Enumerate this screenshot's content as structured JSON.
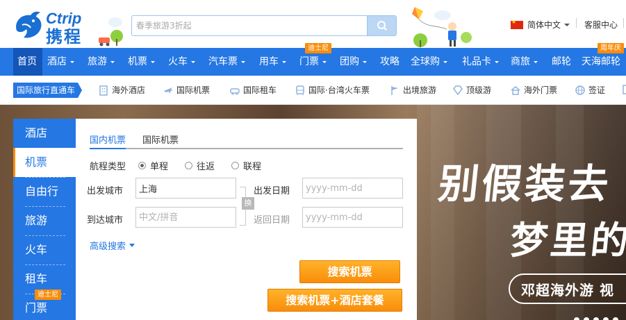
{
  "header": {
    "logo_en": "Ctrip",
    "logo_cn": "携程",
    "search_placeholder": "春季旅游3折起",
    "language": "简体中文",
    "customer_service": "客服中心"
  },
  "nav": {
    "items": [
      {
        "label": "首页",
        "arrow": false
      },
      {
        "label": "酒店",
        "arrow": true
      },
      {
        "label": "旅游",
        "arrow": true
      },
      {
        "label": "机票",
        "arrow": true
      },
      {
        "label": "火车",
        "arrow": true
      },
      {
        "label": "汽车票",
        "arrow": true
      },
      {
        "label": "用车",
        "arrow": true
      },
      {
        "label": "门票",
        "arrow": true
      },
      {
        "label": "团购",
        "arrow": true
      },
      {
        "label": "攻略",
        "arrow": false
      },
      {
        "label": "全球购",
        "arrow": true
      },
      {
        "label": "礼品卡",
        "arrow": true
      },
      {
        "label": "商旅",
        "arrow": true
      },
      {
        "label": "邮轮",
        "arrow": false
      },
      {
        "label": "天海邮轮",
        "arrow": false
      }
    ],
    "tag_disney": "迪士尼",
    "tag_anniversary": "周年庆"
  },
  "subnav": {
    "title": "国际旅行直通车",
    "items": [
      {
        "label": "海外酒店",
        "icon": "hotel-building-icon"
      },
      {
        "label": "国际机票",
        "icon": "airplane-icon"
      },
      {
        "label": "国际租车",
        "icon": "car-icon"
      },
      {
        "label": "国际·台湾火车票",
        "icon": "train-icon"
      },
      {
        "label": "出境旅游",
        "icon": "travel-flag-icon"
      },
      {
        "label": "顶级游",
        "icon": "diamond-icon"
      },
      {
        "label": "海外门票",
        "icon": "ticket-house-icon"
      },
      {
        "label": "签证",
        "icon": "globe-icon"
      }
    ]
  },
  "sidebar": {
    "items": [
      "酒店",
      "机票",
      "自由行",
      "旅游",
      "火车",
      "租车",
      "门票"
    ],
    "active_index": 1,
    "tag_disney": "迪士尼"
  },
  "flight_form": {
    "tabs": [
      "国内机票",
      "国际机票"
    ],
    "active_tab": 0,
    "trip_type_label": "航程类型",
    "trip_types": [
      "单程",
      "往返",
      "联程"
    ],
    "selected_trip_type": 0,
    "depart_city_label": "出发城市",
    "depart_city_value": "上海",
    "arrive_city_label": "到达城市",
    "arrive_city_placeholder": "中文/拼音",
    "swap_label": "换",
    "depart_date_label": "出发日期",
    "depart_date_placeholder": "yyyy-mm-dd",
    "return_date_label": "返回日期",
    "return_date_placeholder": "yyyy-mm-dd",
    "advanced_search": "高级搜索",
    "search_button": "搜索机票",
    "search_combo_button": "搜索机票+酒店套餐"
  },
  "banner": {
    "line1": "别假装去",
    "line2": "梦里的",
    "pill": "邓超海外游 视"
  },
  "colors": {
    "brand_blue": "#2577e3",
    "nav_active": "#1456b8",
    "orange": "#f98d0b"
  }
}
